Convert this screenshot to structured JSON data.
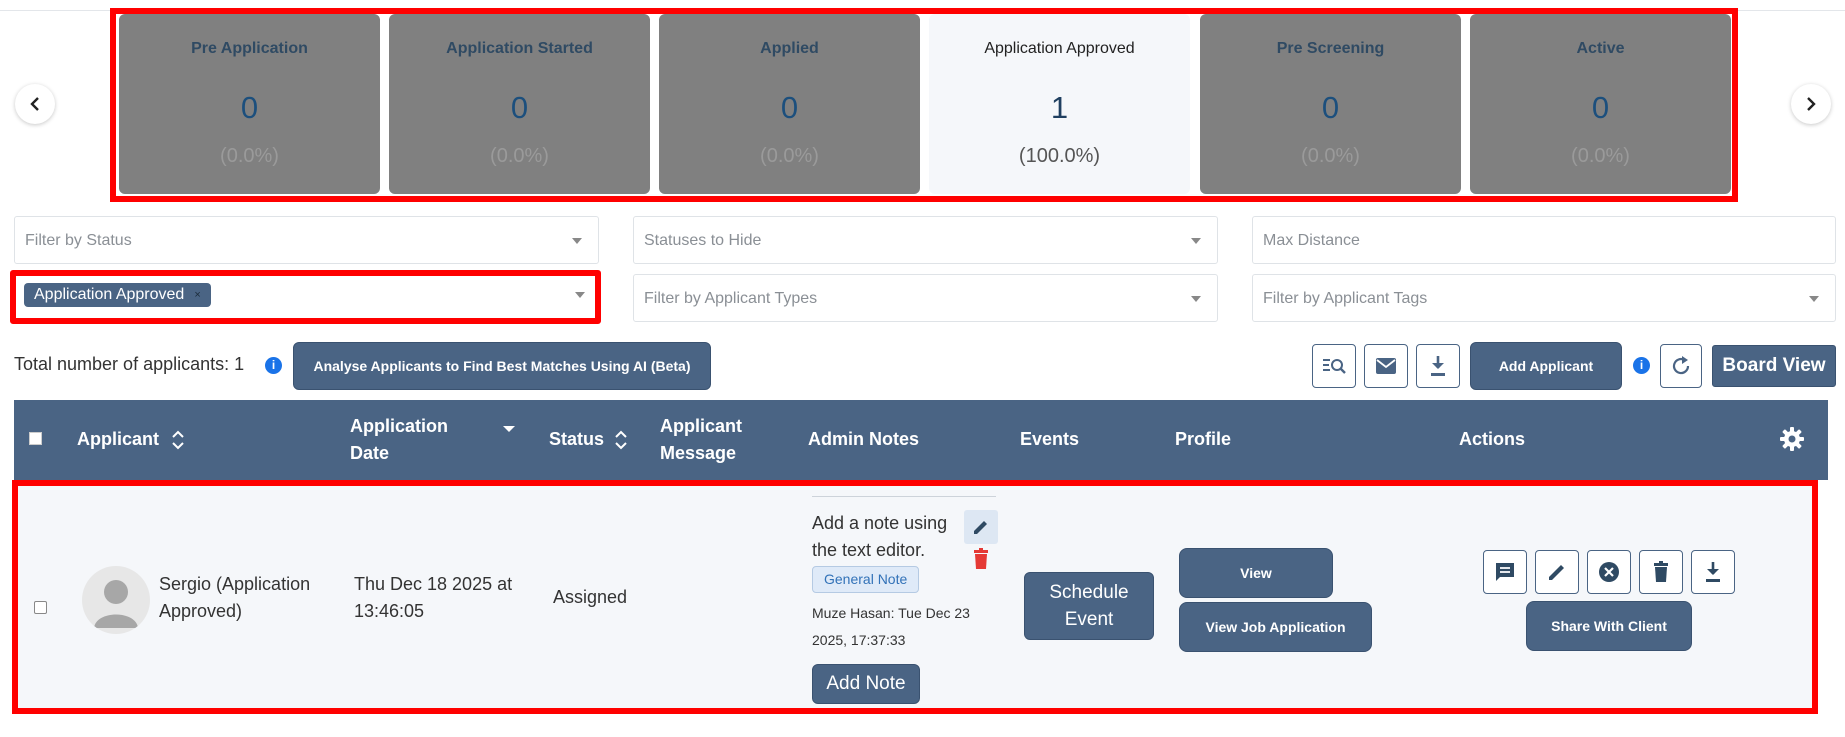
{
  "status_cards": [
    {
      "title": "Pre Application",
      "count": "0",
      "percent": "(0.0%)",
      "active": false
    },
    {
      "title": "Application Started",
      "count": "0",
      "percent": "(0.0%)",
      "active": false
    },
    {
      "title": "Applied",
      "count": "0",
      "percent": "(0.0%)",
      "active": false
    },
    {
      "title": "Application Approved",
      "count": "1",
      "percent": "(100.0%)",
      "active": true
    },
    {
      "title": "Pre Screening",
      "count": "0",
      "percent": "(0.0%)",
      "active": false
    },
    {
      "title": "Active",
      "count": "0",
      "percent": "(0.0%)",
      "active": false
    }
  ],
  "nav": {
    "prev": "‹",
    "next": "›"
  },
  "filters": {
    "status_placeholder": "Filter by Status",
    "statuses_hide_placeholder": "Statuses to Hide",
    "max_distance_placeholder": "Max Distance",
    "selected_chip": "Application Approved",
    "chip_remove": "×",
    "applicant_types_placeholder": "Filter by Applicant Types",
    "applicant_tags_placeholder": "Filter by Applicant Tags"
  },
  "toolbar": {
    "total_label": "Total number of applicants: 1",
    "info": "i",
    "analyse_button": "Analyse Applicants to Find Best Matches Using AI (Beta)",
    "add_applicant": "Add Applicant",
    "board_view": "Board View"
  },
  "table": {
    "headers": {
      "applicant": "Applicant",
      "application_date_line1": "Application",
      "application_date_line2": "Date",
      "status": "Status",
      "message_line1": "Applicant",
      "message_line2": "Message",
      "admin_notes": "Admin Notes",
      "events": "Events",
      "profile": "Profile",
      "actions": "Actions"
    },
    "row": {
      "applicant_name": "Sergio (Application Approved)",
      "date": "Thu Dec 18 2025 at 13:46:05",
      "status": "Assigned",
      "note_text": "Add a note using the text editor.",
      "note_tag": "General Note",
      "note_meta": "Muze Hasan: Tue Dec 23 2025, 17:37:33",
      "add_note": "Add Note",
      "schedule_event": "Schedule Event",
      "view": "View",
      "view_job_application": "View Job Application",
      "share_with_client": "Share With Client"
    }
  },
  "colors": {
    "accent": "#4a6484",
    "highlight": "#ff0000",
    "card_inactive": "#808080",
    "count_blue": "#1c4f7d",
    "info_blue": "#1a73e8",
    "delete_red": "#e53935"
  }
}
